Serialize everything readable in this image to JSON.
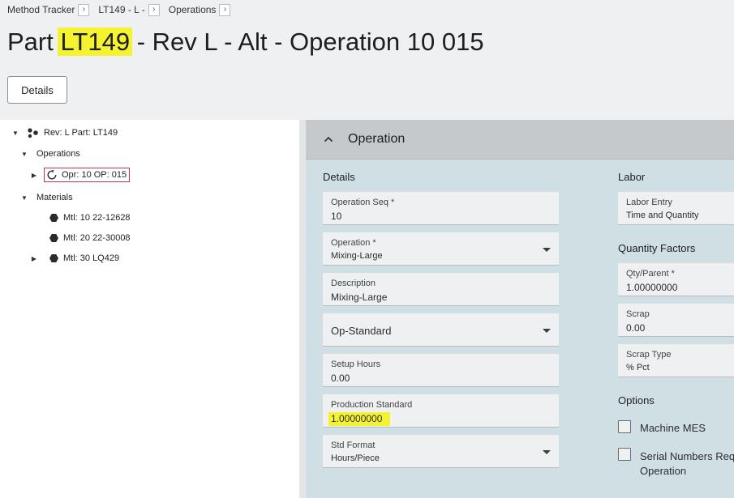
{
  "breadcrumb": [
    {
      "label": "Method Tracker"
    },
    {
      "label": "LT149 - L -"
    },
    {
      "label": "Operations"
    }
  ],
  "title": {
    "prefix": "Part ",
    "part": "LT149",
    "suffix": " - Rev L - Alt - Operation 10 015"
  },
  "details_button": "Details",
  "tree": {
    "root": "Rev: L Part: LT149",
    "operations_label": "Operations",
    "operation_node": "Opr: 10 OP: 015",
    "materials_label": "Materials",
    "materials": [
      "Mtl: 10 22-12628",
      "Mtl: 20 22-30008",
      "Mtl: 30 LQ429"
    ]
  },
  "panel": {
    "title": "Operation",
    "details_section": "Details",
    "labor_section": "Labor",
    "quantity_section": "Quantity Factors",
    "options_section": "Options",
    "fields": {
      "operation_seq": {
        "label": "Operation Seq *",
        "value": "10"
      },
      "operation": {
        "label": "Operation *",
        "value": "Mixing-Large"
      },
      "description": {
        "label": "Description",
        "value": "Mixing-Large"
      },
      "op_standard": {
        "value": "Op-Standard"
      },
      "setup_hours": {
        "label": "Setup Hours",
        "value": "0.00"
      },
      "production_standard": {
        "label": "Production Standard",
        "value": "1.00000000"
      },
      "std_format": {
        "label": "Std Format",
        "value": "Hours/Piece"
      },
      "labor_entry": {
        "label": "Labor Entry",
        "value": "Time and Quantity"
      },
      "qty_parent": {
        "label": "Qty/Parent *",
        "value": "1.00000000"
      },
      "scrap": {
        "label": "Scrap",
        "value": "0.00"
      },
      "scrap_type": {
        "label": "Scrap Type",
        "value": "% Pct"
      }
    },
    "options": {
      "machine_mes": "Machine MES",
      "serial_numbers_line1": "Serial Numbers Req",
      "serial_numbers_line2": "Operation"
    }
  },
  "colors": {
    "highlight": "#f5f230",
    "selected_border": "#c0335a",
    "panel_bg": "#cfdfe4"
  }
}
